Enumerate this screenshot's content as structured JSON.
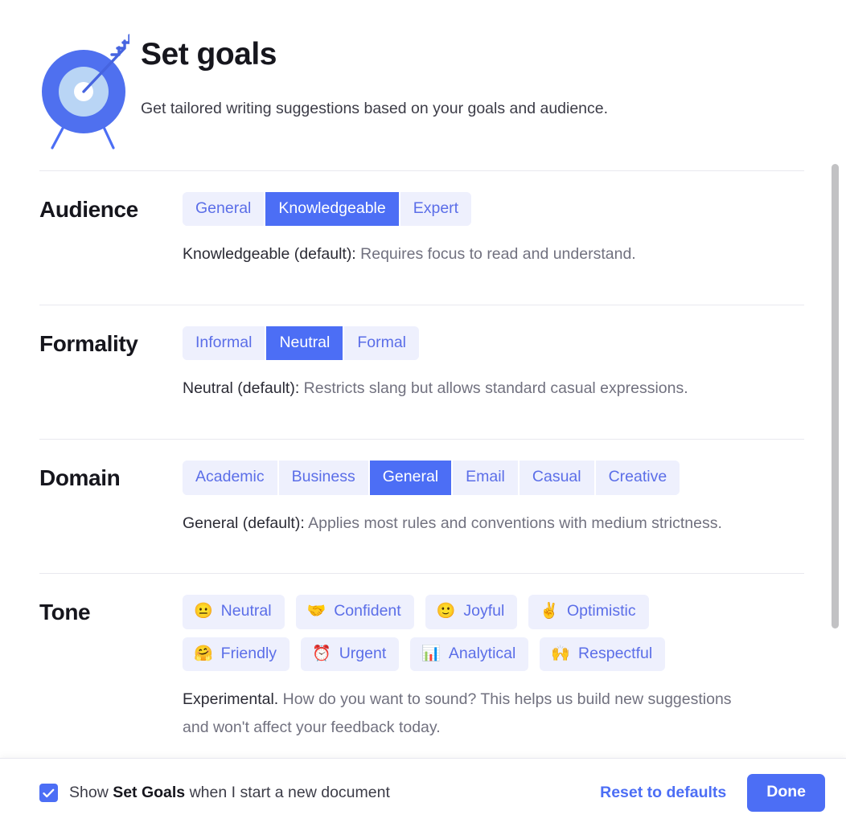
{
  "header": {
    "icon": "target-with-arrow-icon",
    "title": "Set goals",
    "subtitle": "Get tailored writing suggestions based on your goals and audience."
  },
  "colors": {
    "accent": "#4c6ef5",
    "chip_bg": "#eef0fd",
    "chip_text": "#5b6ee8",
    "title": "#16161d",
    "muted_text": "#71717f"
  },
  "sections": [
    {
      "label": "Audience",
      "type": "segmented",
      "options": [
        "General",
        "Knowledgeable",
        "Expert"
      ],
      "selected": "Knowledgeable",
      "description_lead": "Knowledgeable (default):",
      "description_rest": " Requires focus to read and understand."
    },
    {
      "label": "Formality",
      "type": "segmented",
      "options": [
        "Informal",
        "Neutral",
        "Formal"
      ],
      "selected": "Neutral",
      "description_lead": "Neutral (default):",
      "description_rest": " Restricts slang but allows standard casual expressions."
    },
    {
      "label": "Domain",
      "type": "segmented",
      "options": [
        "Academic",
        "Business",
        "General",
        "Email",
        "Casual",
        "Creative"
      ],
      "selected": "General",
      "description_lead": "General (default):",
      "description_rest": " Applies most rules and conventions with medium strictness."
    },
    {
      "label": "Tone",
      "type": "chips",
      "chips": [
        {
          "emoji": "😐",
          "icon_name": "neutral-face-emoji",
          "label": "Neutral"
        },
        {
          "emoji": "🤝",
          "icon_name": "handshake-emoji",
          "label": "Confident"
        },
        {
          "emoji": "🙂",
          "icon_name": "slightly-smiling-face-emoji",
          "label": "Joyful"
        },
        {
          "emoji": "✌️",
          "icon_name": "victory-hand-emoji",
          "label": "Optimistic"
        },
        {
          "emoji": "🤗",
          "icon_name": "hugging-face-emoji",
          "label": "Friendly"
        },
        {
          "emoji": "⏰",
          "icon_name": "alarm-clock-emoji",
          "label": "Urgent"
        },
        {
          "emoji": "📊",
          "icon_name": "bar-chart-emoji",
          "label": "Analytical"
        },
        {
          "emoji": "🙌",
          "icon_name": "raising-hands-emoji",
          "label": "Respectful"
        }
      ],
      "description_lead": "Experimental.",
      "description_rest": " How do you want to sound? This helps us build new suggestions and won't affect your feedback today."
    }
  ],
  "footer": {
    "checkbox_checked": true,
    "checkbox_label_prefix": "Show ",
    "checkbox_label_bold": "Set Goals",
    "checkbox_label_suffix": " when I start a new document",
    "reset_label": "Reset to defaults",
    "done_label": "Done"
  }
}
